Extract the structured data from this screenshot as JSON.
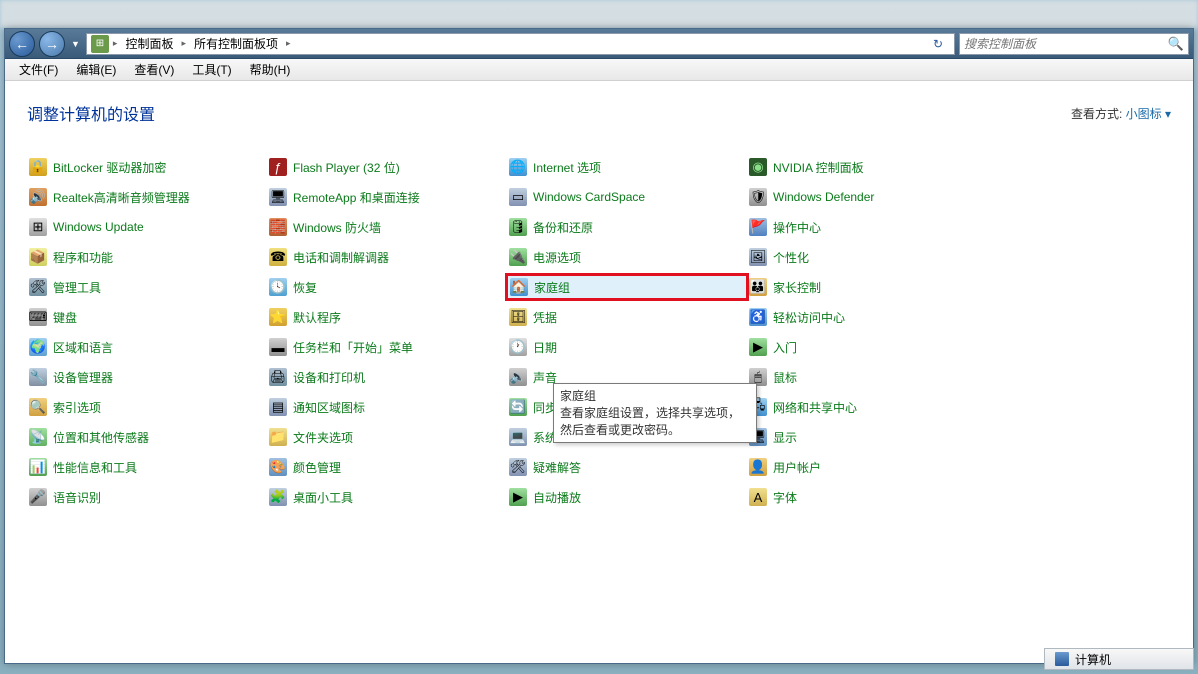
{
  "breadcrumb": {
    "level1": "控制面板",
    "level2": "所有控制面板项"
  },
  "search": {
    "placeholder": "搜索控制面板"
  },
  "menu": {
    "file": "文件(F)",
    "edit": "编辑(E)",
    "view": "查看(V)",
    "tools": "工具(T)",
    "help": "帮助(H)"
  },
  "heading": "调整计算机的设置",
  "viewby": {
    "label": "查看方式:",
    "value": "小图标 ▾"
  },
  "tooltip": {
    "title": "家庭组",
    "body": "查看家庭组设置，选择共享选项，然后查看或更改密码。"
  },
  "statusbar": {
    "label": "计算机"
  },
  "cols": {
    "c1": [
      "BitLocker 驱动器加密",
      "Realtek高清晰音频管理器",
      "Windows Update",
      "程序和功能",
      "管理工具",
      "键盘",
      "区域和语言",
      "设备管理器",
      "索引选项",
      "位置和其他传感器",
      "性能信息和工具",
      "语音识别"
    ],
    "c2": [
      "Flash Player (32 位)",
      "RemoteApp 和桌面连接",
      "Windows 防火墙",
      "电话和调制解调器",
      "恢复",
      "默认程序",
      "任务栏和「开始」菜单",
      "设备和打印机",
      "通知区域图标",
      "文件夹选项",
      "颜色管理",
      "桌面小工具"
    ],
    "c3": [
      "Internet 选项",
      "Windows CardSpace",
      "备份和还原",
      "电源选项",
      "家庭组",
      "凭据",
      "日期",
      "声音",
      "同步中心",
      "系统",
      "疑难解答",
      "自动播放"
    ],
    "c4": [
      "NVIDIA 控制面板",
      "Windows Defender",
      "操作中心",
      "个性化",
      "家长控制",
      "轻松访问中心",
      "入门",
      "鼠标",
      "网络和共享中心",
      "显示",
      "用户帐户",
      "字体"
    ]
  }
}
